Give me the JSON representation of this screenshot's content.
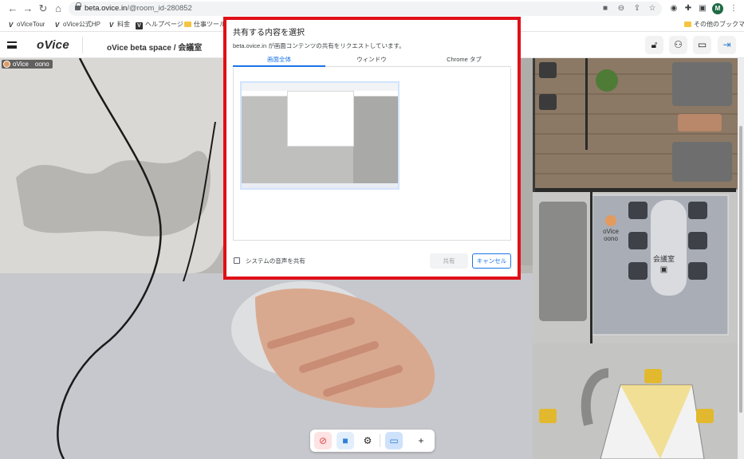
{
  "browser": {
    "url_host": "beta.ovice.in",
    "url_path": "/@room_id-280852",
    "profile_initial": "M",
    "icons": [
      "back-icon",
      "forward-icon",
      "reload-icon",
      "home-icon",
      "lock-icon",
      "camera-icon",
      "zoom-icon",
      "share-icon",
      "star-icon",
      "extension-icon",
      "puzzle-icon",
      "sidepanel-icon",
      "more-icon"
    ],
    "bookmarks": [
      {
        "label": "oViceTour",
        "icon": "v"
      },
      {
        "label": "oVice公式HP",
        "icon": "v"
      },
      {
        "label": "料金",
        "icon": "v"
      },
      {
        "label": "ヘルプページ",
        "icon": "vbox"
      },
      {
        "label": "仕事ツール",
        "icon": "folder"
      }
    ],
    "other_bookmarks": "その他のブックマーク"
  },
  "app": {
    "logo": "oVice",
    "space_title": "oVice beta space / 会議室",
    "header_icons": [
      "lock-icon",
      "members-icon",
      "chat-icon",
      "exit-icon"
    ]
  },
  "video": {
    "tag_org": "oVice",
    "tag_user": "oono"
  },
  "map": {
    "avatar_org": "oVice",
    "avatar_user": "oono",
    "room_name": "会議室"
  },
  "toolbar": {
    "icons": [
      "mic-off-icon",
      "camera-icon",
      "settings-icon",
      "screen-share-icon",
      "plus-icon"
    ]
  },
  "share_dialog": {
    "title": "共有する内容を選択",
    "description": "beta.ovice.in が画面コンテンツの共有をリクエストしています。",
    "tabs": [
      "画面全体",
      "ウィンドウ",
      "Chrome タブ"
    ],
    "active_tab": "画面全体",
    "audio_label": "システムの音声を共有",
    "share_button": "共有",
    "cancel_button": "キャンセル",
    "frame_color": "#e01018",
    "accent_color": "#1a73e8"
  }
}
